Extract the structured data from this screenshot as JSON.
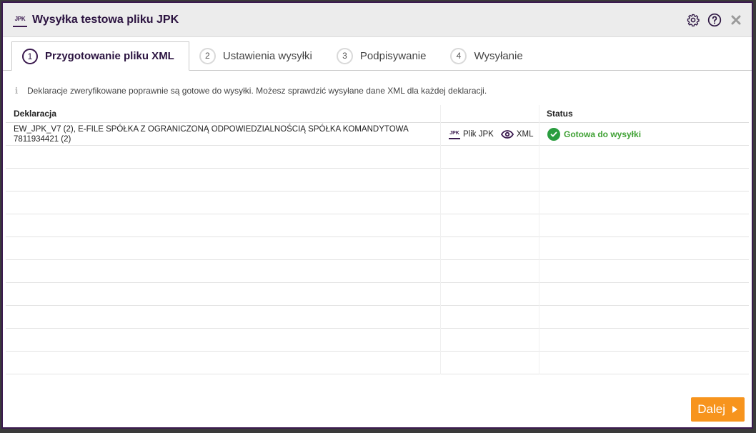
{
  "dialog": {
    "title": "Wysyłka testowa pliku JPK",
    "logo_text": "JPK"
  },
  "tabs": [
    {
      "num": "1",
      "label": "Przygotowanie pliku XML",
      "active": true
    },
    {
      "num": "2",
      "label": "Ustawienia wysyłki",
      "active": false
    },
    {
      "num": "3",
      "label": "Podpisywanie",
      "active": false
    },
    {
      "num": "4",
      "label": "Wysyłanie",
      "active": false
    }
  ],
  "info": {
    "text": "Deklaracje zweryfikowane poprawnie są gotowe do wysyłki. Możesz sprawdzić wysyłane dane XML dla każdej deklaracji."
  },
  "table": {
    "headers": {
      "declaration": "Deklaracja",
      "status": "Status"
    },
    "rows": [
      {
        "line1": "EW_JPK_V7 (2), E-FILE SPÓŁKA Z OGRANICZONĄ ODPOWIEDZIALNOŚCIĄ SPÓŁKA KOMANDYTOWA",
        "line2": "7811934421 (2)",
        "jpk_icon_text": "JPK",
        "jpk_link": "Plik JPK",
        "xml_link": "XML",
        "status": "Gotowa do wysyłki"
      }
    ]
  },
  "footer": {
    "next_label": "Dalej"
  },
  "colors": {
    "brand": "#3b1a4f",
    "accent": "#f7941d",
    "success": "#3fa134"
  },
  "icons": {
    "settings": "gear-icon",
    "help": "help-icon",
    "close": "close-icon",
    "info": "info-icon",
    "view": "eye-icon",
    "status_ok": "check-circle-icon"
  }
}
